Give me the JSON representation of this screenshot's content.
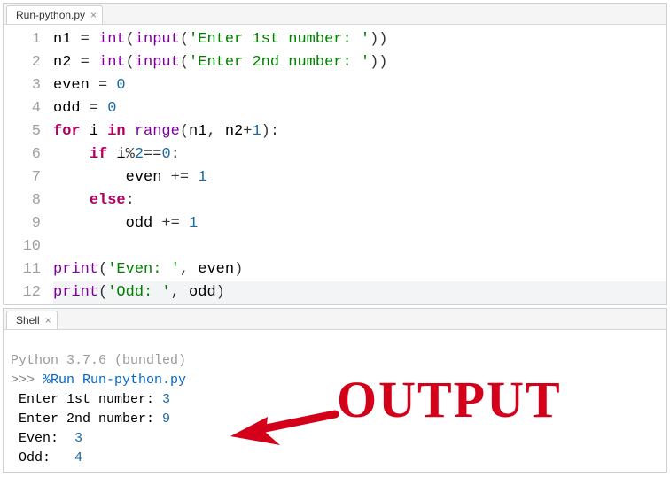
{
  "editor": {
    "tab_label": "Run-python.py",
    "line_count": 12,
    "lines": [
      {
        "n": "1",
        "tokens": [
          [
            "id",
            "n1"
          ],
          [
            "op",
            " = "
          ],
          [
            "fn",
            "int"
          ],
          [
            "op",
            "("
          ],
          [
            "fn",
            "input"
          ],
          [
            "op",
            "("
          ],
          [
            "str",
            "'Enter 1st number: '"
          ],
          [
            "op",
            "))"
          ]
        ]
      },
      {
        "n": "2",
        "tokens": [
          [
            "id",
            "n2"
          ],
          [
            "op",
            " = "
          ],
          [
            "fn",
            "int"
          ],
          [
            "op",
            "("
          ],
          [
            "fn",
            "input"
          ],
          [
            "op",
            "("
          ],
          [
            "str",
            "'Enter 2nd number: '"
          ],
          [
            "op",
            "))"
          ]
        ]
      },
      {
        "n": "3",
        "tokens": [
          [
            "id",
            "even"
          ],
          [
            "op",
            " = "
          ],
          [
            "num",
            "0"
          ]
        ]
      },
      {
        "n": "4",
        "tokens": [
          [
            "id",
            "odd"
          ],
          [
            "op",
            " = "
          ],
          [
            "num",
            "0"
          ]
        ]
      },
      {
        "n": "5",
        "tokens": [
          [
            "kw",
            "for"
          ],
          [
            "op",
            " "
          ],
          [
            "id",
            "i"
          ],
          [
            "op",
            " "
          ],
          [
            "kw",
            "in"
          ],
          [
            "op",
            " "
          ],
          [
            "fn",
            "range"
          ],
          [
            "op",
            "("
          ],
          [
            "id",
            "n1"
          ],
          [
            "op",
            ", "
          ],
          [
            "id",
            "n2"
          ],
          [
            "op",
            "+"
          ],
          [
            "num",
            "1"
          ],
          [
            "op",
            "):"
          ]
        ]
      },
      {
        "n": "6",
        "tokens": [
          [
            "op",
            "    "
          ],
          [
            "kw",
            "if"
          ],
          [
            "op",
            " "
          ],
          [
            "id",
            "i"
          ],
          [
            "op",
            "%"
          ],
          [
            "num",
            "2"
          ],
          [
            "op",
            "=="
          ],
          [
            "num",
            "0"
          ],
          [
            "op",
            ":"
          ]
        ]
      },
      {
        "n": "7",
        "tokens": [
          [
            "op",
            "        "
          ],
          [
            "id",
            "even"
          ],
          [
            "op",
            " += "
          ],
          [
            "num",
            "1"
          ]
        ]
      },
      {
        "n": "8",
        "tokens": [
          [
            "op",
            "    "
          ],
          [
            "kw",
            "else"
          ],
          [
            "op",
            ":"
          ]
        ]
      },
      {
        "n": "9",
        "tokens": [
          [
            "op",
            "        "
          ],
          [
            "id",
            "odd"
          ],
          [
            "op",
            " += "
          ],
          [
            "num",
            "1"
          ]
        ]
      },
      {
        "n": "10",
        "tokens": []
      },
      {
        "n": "11",
        "tokens": [
          [
            "fn",
            "print"
          ],
          [
            "op",
            "("
          ],
          [
            "str",
            "'Even: '"
          ],
          [
            "op",
            ", "
          ],
          [
            "id",
            "even"
          ],
          [
            "op",
            ")"
          ]
        ]
      },
      {
        "n": "12",
        "tokens": [
          [
            "fn",
            "print"
          ],
          [
            "op",
            "("
          ],
          [
            "str",
            "'Odd: '"
          ],
          [
            "op",
            ", "
          ],
          [
            "id",
            "odd"
          ],
          [
            "op",
            ")"
          ]
        ],
        "highlight": true
      }
    ]
  },
  "shell": {
    "tab_label": "Shell",
    "version_line": "Python 3.7.6 (bundled)",
    "prompt": ">>>",
    "run_cmd": "%Run Run-python.py",
    "output": [
      {
        "text": "Enter 1st number: ",
        "val": "3"
      },
      {
        "text": "Enter 2nd number: ",
        "val": "9"
      },
      {
        "text": "Even:  ",
        "val": "3"
      },
      {
        "text": "Odd:   ",
        "val": "4"
      }
    ]
  },
  "annotation": {
    "label": "OUTPUT"
  }
}
